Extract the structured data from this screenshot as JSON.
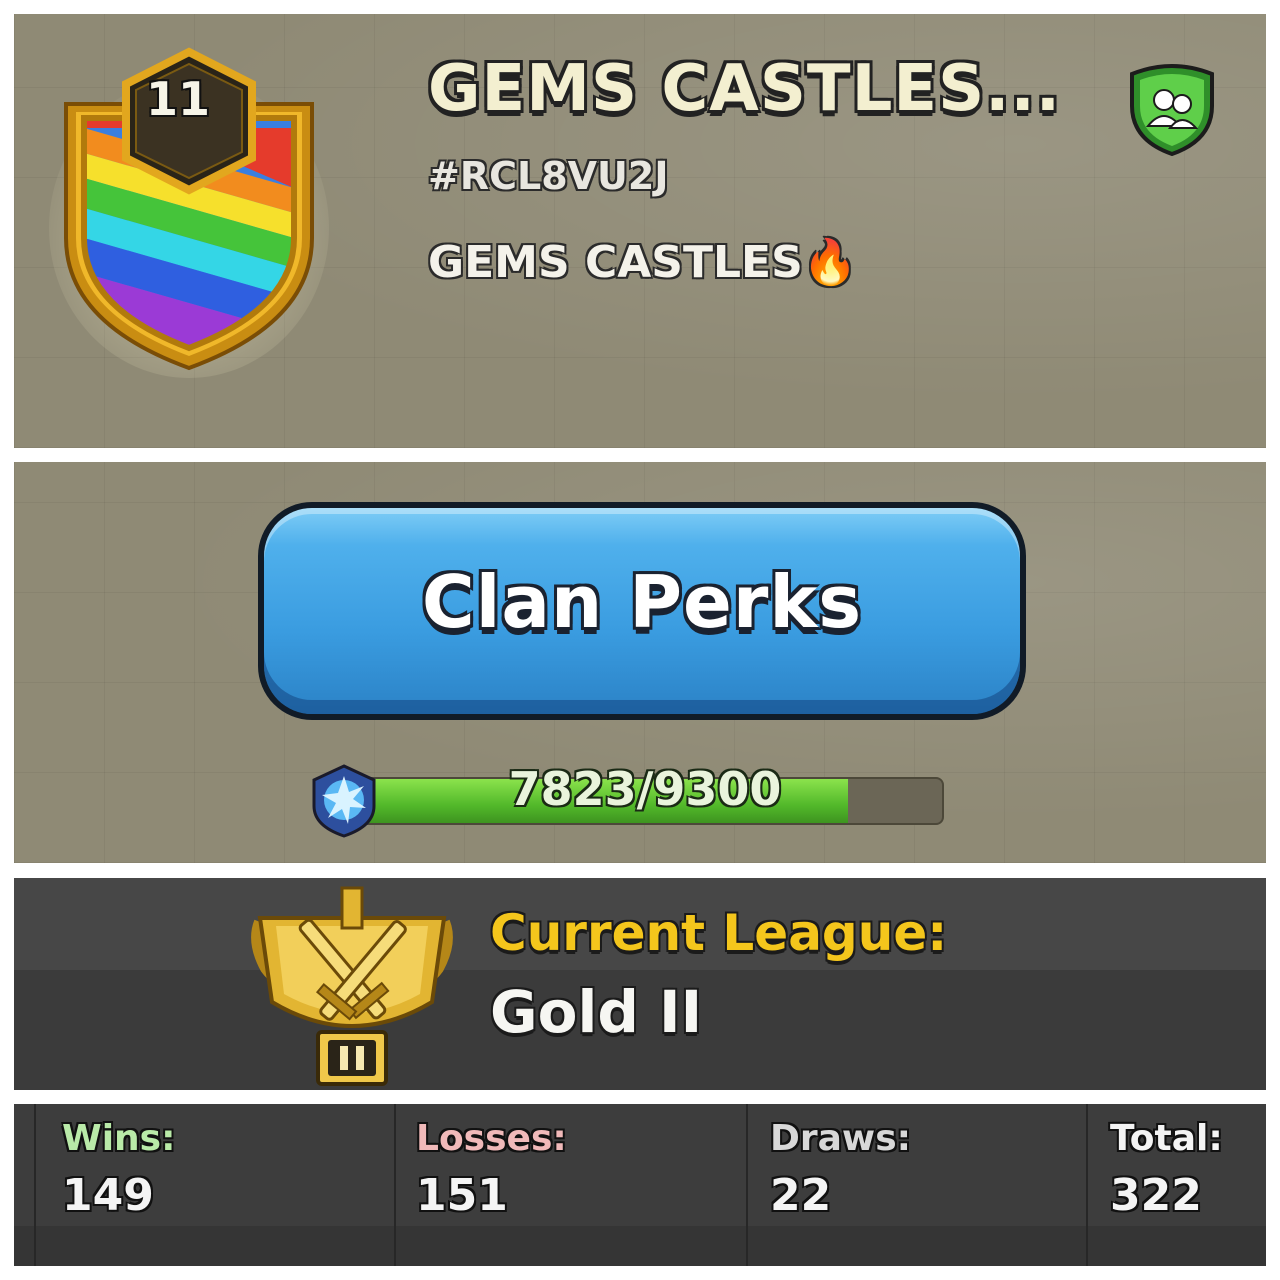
{
  "clan": {
    "name": "GEMS CASTLES...",
    "tag": "#RCL8VU2J",
    "description": "GEMS CASTLES🔥",
    "level": "11",
    "badge_icon": "rainbow-shield-badge",
    "membership_icon": "friends-shield-icon"
  },
  "perks": {
    "button_label": "Clan Perks",
    "xp_text": "7823/9300",
    "xp_current": 7823,
    "xp_max": 9300,
    "xp_icon": "clan-xp-star-icon"
  },
  "league": {
    "title": "Current League:",
    "name": "Gold II",
    "icon": "gold-league-trophy-icon",
    "tier_mark": "II"
  },
  "stats": {
    "wins_label": "Wins:",
    "wins_value": "149",
    "losses_label": "Losses:",
    "losses_value": "151",
    "draws_label": "Draws:",
    "draws_value": "22",
    "total_label": "Total:",
    "total_value": "322"
  },
  "colors": {
    "button_blue": "#3a9ce0",
    "league_gold": "#f4c61c",
    "wins_green": "#b9eaa8",
    "losses_pink": "#f0b9b9",
    "draws_grey": "#d8d8d8",
    "xp_green": "#52b82a"
  }
}
